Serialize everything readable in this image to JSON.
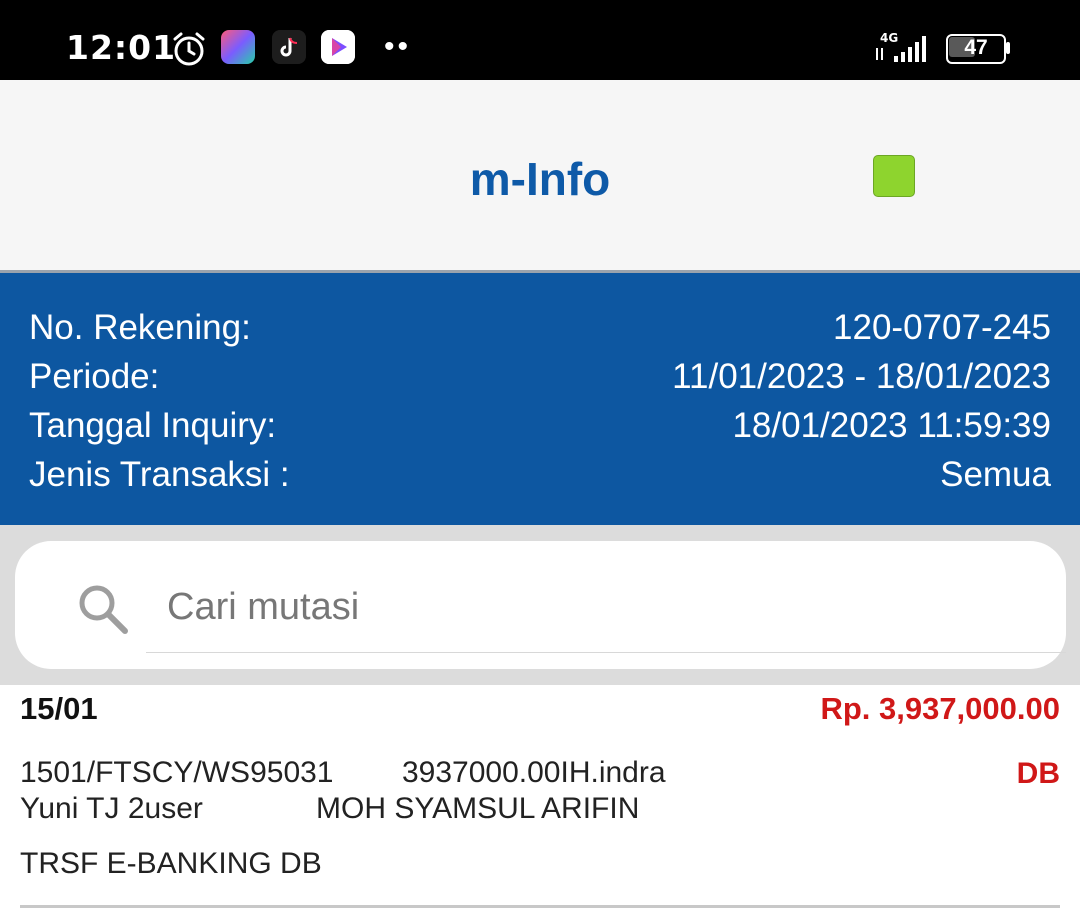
{
  "status_bar": {
    "time": "12:01",
    "network": "4G",
    "battery": "47",
    "icons": [
      "alarm-icon",
      "app-icon",
      "tiktok-icon",
      "play-icon",
      "more-dots-icon",
      "signal-icon",
      "battery-icon"
    ]
  },
  "header": {
    "title": "m-Info",
    "status_color": "#8ed42e"
  },
  "account_info": {
    "rows": [
      {
        "label": "No. Rekening:",
        "value": "120-0707-245"
      },
      {
        "label": "Periode:",
        "value": "11/01/2023 - 18/01/2023"
      },
      {
        "label": "Tanggal Inquiry:",
        "value": "18/01/2023 11:59:39"
      },
      {
        "label": "Jenis Transaksi :",
        "value": "Semua"
      }
    ]
  },
  "search": {
    "placeholder": "Cari mutasi",
    "value": ""
  },
  "transactions": [
    {
      "date": "15/01",
      "amount": "Rp. 3,937,000.00",
      "line1_col1": "1501/FTSCY/WS95031",
      "line1_col2": "3937000.00IH.indra",
      "type": "DB",
      "line2_col1": "Yuni TJ 2user",
      "line2_col2": "MOH SYAMSUL ARIFIN",
      "description": "TRSF E-BANKING DB"
    }
  ],
  "colors": {
    "primary_blue": "#0d57a1",
    "debit_red": "#d01818"
  }
}
